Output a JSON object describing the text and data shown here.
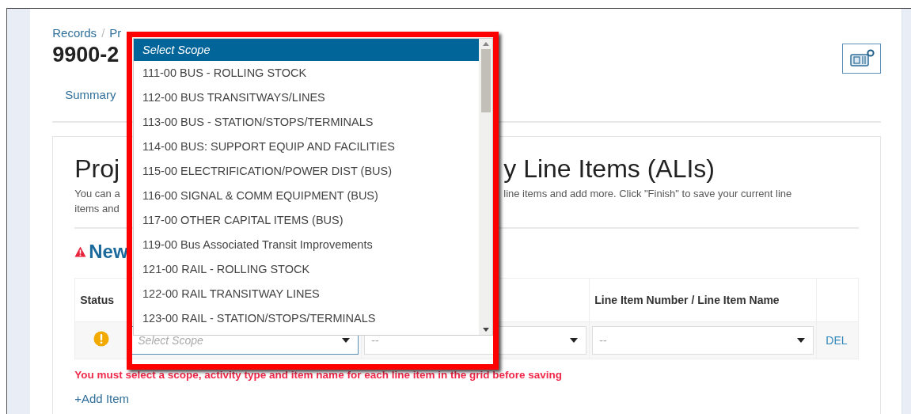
{
  "breadcrumb": [
    {
      "label": "Records"
    },
    {
      "label": "Pr"
    }
  ],
  "breadcrumb_separator": "/",
  "title": "9900-2",
  "tabs": [
    {
      "label": "Summary"
    }
  ],
  "section": {
    "heading_left": "Proj",
    "heading_right": "y Line Items (ALIs)",
    "description_left": [
      "You can a",
      "items and"
    ],
    "description_right": "line items and add more. Click \"Finish\" to save your current line"
  },
  "new_heading": "New",
  "table": {
    "columns": {
      "status": "Status",
      "line_item": "Line Item Number / Line Item Name"
    },
    "rows": [
      {
        "warning": true,
        "scope": {
          "placeholder": "Select Scope",
          "focused": true
        },
        "activity": {
          "placeholder": "--",
          "focused": false
        },
        "line_item": {
          "placeholder": "--",
          "focused": false
        },
        "action": "DEL"
      }
    ]
  },
  "error": "You must select a scope, activity type and item name for each line item in the grid before saving",
  "add_item": "+Add Item",
  "dropdown": {
    "options": [
      {
        "label": "Select Scope",
        "kind": "placeholder",
        "selected": true
      },
      {
        "label": "111-00 BUS - ROLLING STOCK",
        "kind": "option",
        "selected": false
      },
      {
        "label": "112-00 BUS TRANSITWAYS/LINES",
        "kind": "option",
        "selected": false
      },
      {
        "label": "113-00 BUS - STATION/STOPS/TERMINALS",
        "kind": "option",
        "selected": false
      },
      {
        "label": "114-00 BUS: SUPPORT EQUIP AND FACILITIES",
        "kind": "option",
        "selected": false
      },
      {
        "label": "115-00 ELECTRIFICATION/POWER DIST (BUS)",
        "kind": "option",
        "selected": false
      },
      {
        "label": "116-00 SIGNAL & COMM EQUIPMENT (BUS)",
        "kind": "option",
        "selected": false
      },
      {
        "label": "117-00 OTHER CAPITAL ITEMS (BUS)",
        "kind": "option",
        "selected": false
      },
      {
        "label": "119-00 Bus Associated Transit Improvements",
        "kind": "option",
        "selected": false
      },
      {
        "label": "121-00 RAIL - ROLLING STOCK",
        "kind": "option",
        "selected": false
      },
      {
        "label": "122-00 RAIL TRANSITWAY LINES",
        "kind": "option",
        "selected": false
      },
      {
        "label": "123-00 RAIL - STATION/STOPS/TERMINALS",
        "kind": "option",
        "selected": false
      }
    ]
  }
}
